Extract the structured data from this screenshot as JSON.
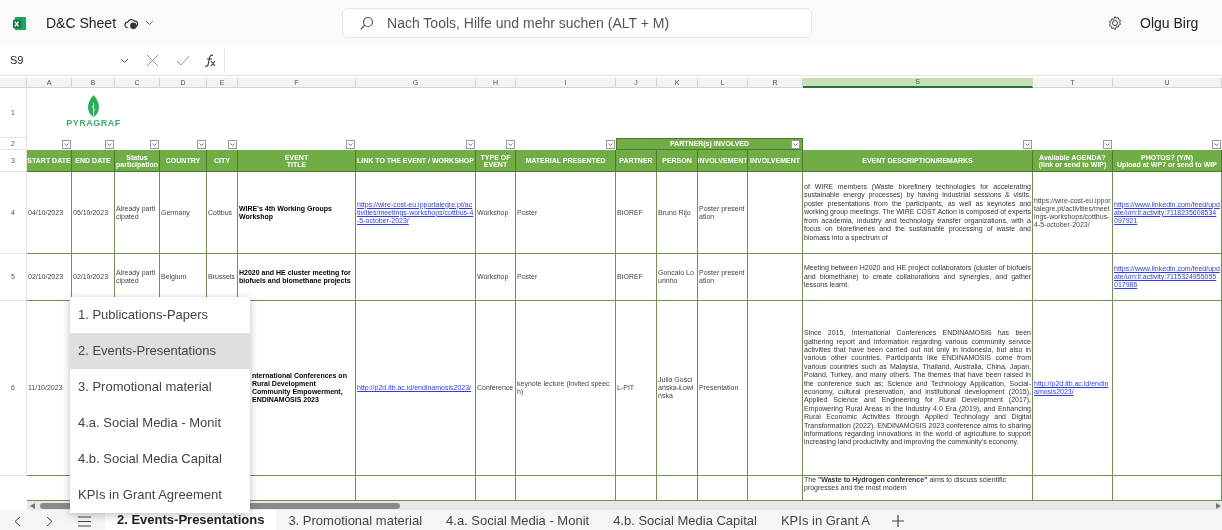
{
  "app": {
    "file_name": "D&C Sheet",
    "search_placeholder": "Nach Tools, Hilfe und mehr suchen (ALT + M)",
    "user": "Olgu Birg"
  },
  "formula_bar": {
    "name_box": "S9"
  },
  "column_letters": [
    {
      "letter": "A",
      "selected": false
    },
    {
      "letter": "B",
      "selected": false
    },
    {
      "letter": "C",
      "selected": false
    },
    {
      "letter": "D",
      "selected": false
    },
    {
      "letter": "E",
      "selected": false
    },
    {
      "letter": "F",
      "selected": false
    },
    {
      "letter": "G",
      "selected": false
    },
    {
      "letter": "H",
      "selected": false
    },
    {
      "letter": "I",
      "selected": false
    },
    {
      "letter": "J",
      "selected": false
    },
    {
      "letter": "K",
      "selected": false
    },
    {
      "letter": "L",
      "selected": false
    },
    {
      "letter": "R",
      "selected": false
    },
    {
      "letter": "S",
      "selected": true
    },
    {
      "letter": "T",
      "selected": false
    },
    {
      "letter": "U",
      "selected": false
    }
  ],
  "logo": {
    "text": "PYRAGRAF"
  },
  "row_numbers": [
    "1",
    "2",
    "3"
  ],
  "partner_group": {
    "label": "PARTNER(s) INVOLVED",
    "filter": true
  },
  "headers": [
    {
      "label": "START DATE",
      "filter": true
    },
    {
      "label": "END DATE",
      "filter": true
    },
    {
      "label": "Status participation",
      "filter": true
    },
    {
      "label": "COUNTRY",
      "filter": true
    },
    {
      "label": "CITY",
      "filter": true
    },
    {
      "label": "EVENT\nTITLE",
      "filter": true
    },
    {
      "label": "LINK TO THE EVENT / WORKSHOP",
      "filter": true
    },
    {
      "label": "TYPE OF EVENT",
      "filter": true
    },
    {
      "label": "MATERIAL PRESENTED",
      "filter": true
    },
    {
      "label": "PARTNER",
      "filter": false
    },
    {
      "label": "PERSON",
      "filter": false
    },
    {
      "label": "INVOLVEMENT",
      "filter": false
    },
    {
      "label": "INVOLVEMENT",
      "filter": false
    },
    {
      "label": "EVENT DESCRIPTION/REMARKS",
      "filter": true
    },
    {
      "label": "Available AGENDA? (link or send to WIP)",
      "filter": true
    },
    {
      "label": "PHOTOS? (Y/N)\nUpload at WP7 or send to WIP",
      "filter": true
    }
  ],
  "rows": [
    {
      "number": "4",
      "cells": {
        "start_date": {
          "kind": "text",
          "text": "04/10/2023"
        },
        "end_date": {
          "kind": "text",
          "text": "05/10/2023"
        },
        "status": {
          "kind": "text",
          "text": "Already participated"
        },
        "country": {
          "kind": "text",
          "text": "Germany"
        },
        "city": {
          "kind": "text",
          "text": "Cottbus"
        },
        "event_title": {
          "kind": "title",
          "text": "WIRE's 4th Working Groups Workshop"
        },
        "event_link": {
          "kind": "link",
          "text": "https://wire-cost-eu.ipportalegre.pt/activities/meetings-workshops/cottbus-4-5-october-2023/"
        },
        "event_type": {
          "kind": "text",
          "text": "Workshop"
        },
        "material": {
          "kind": "text",
          "text": "Poster"
        },
        "partner": {
          "kind": "text",
          "text": "BIOREF"
        },
        "person": {
          "kind": "text",
          "text": "Bruno Rijo"
        },
        "involvement": {
          "kind": "text",
          "text": "Poster presentation"
        },
        "description": {
          "kind": "para",
          "text": "of WIRE members (Waste biorefinery technologies for accelerating sustainable energy processes) by having industrial sessions & visits, poster presentations from the participants, as well as keynotes and working group meetings. The WIRE COST Action is composed of experts from academia, industry and technology transfer organizations, with a focus on biorefineries and the sustainable processing of waste and biomass into a spectrum of"
        },
        "agenda": {
          "kind": "text",
          "text": "https://wire-cost-eu.ipportalegre.pt/activities/meetings-workshops/cottbus-4-5-october-2023/"
        },
        "photos": {
          "kind": "link",
          "text": "https://www.linkedin.com/feed/update/urn:li:activity:7118235608534097921"
        }
      }
    },
    {
      "number": "5",
      "cells": {
        "start_date": {
          "kind": "text",
          "text": "02/10/2023"
        },
        "end_date": {
          "kind": "text",
          "text": "02/10/2023"
        },
        "status": {
          "kind": "text",
          "text": "Already participated"
        },
        "country": {
          "kind": "text",
          "text": "Belgium"
        },
        "city": {
          "kind": "text",
          "text": "Brussels"
        },
        "event_title": {
          "kind": "title",
          "text": "H2020 and HE cluster meeting for biofuels and biomethane projects"
        },
        "event_type": {
          "kind": "text",
          "text": "Workshop"
        },
        "material": {
          "kind": "text",
          "text": "Poster"
        },
        "partner": {
          "kind": "text",
          "text": "BIOREF"
        },
        "person": {
          "kind": "text",
          "text": "Goncalo Lourinho"
        },
        "involvement": {
          "kind": "text",
          "text": "Poster presentation"
        },
        "description": {
          "kind": "para",
          "text": "Meeting between H2020 and HE project collaborators (cluster of biofuels and biomethane) to create collaborations and synergies, and gather lessons learnt."
        },
        "photos": {
          "kind": "link",
          "text": "https://www.linkedin.com/feed/update/urn:li:activity:7115324955055017986"
        }
      }
    },
    {
      "number": "6",
      "cells": {
        "start_date": {
          "kind": "text",
          "text": "11/10/2023"
        },
        "event_title": {
          "kind": "title",
          "text": "nternational Conferences on Rural Development Community Empowerment, ENDINAMOSIS 2023"
        },
        "event_link": {
          "kind": "link",
          "text": "http://p2d.itb.ac.id/endinamosis2023/"
        },
        "event_type": {
          "kind": "text",
          "text": "Conference"
        },
        "material": {
          "kind": "text",
          "text": "keynote lecture (invited speech)"
        },
        "partner": {
          "kind": "text",
          "text": "L-PIT"
        },
        "person": {
          "kind": "text",
          "text": "Julia Gościańska-Łowińska"
        },
        "involvement": {
          "kind": "text",
          "text": "Presentation"
        },
        "description": {
          "kind": "para",
          "text": "Since 2015, International Conferences ENDINAMOSIS has been gathering report and information regarding various community service activities that have been carried out not only in Indonesia, but also in various other countries. Participants like ENDINAMOSIS come from various countries such as Malaysia, Thailand, Australia, China, Japan, Poland, Turkey, and many others. The themes that have been raised in the conference such as; Science and Technology Application, Social-economy, cultural preservation, and institutional development (2015), Applied Science and Engineering for Rural Development (2017), Empowering Rural Areas in the Industry 4.0 Era (2019), and Enhancing Rural Economic Activities through Applied Technology and Digital Transformation (2022). ENDINAMOSIS 2023 conference aims to sharing informations regarding innovations in the world of agriculture to support increasing land productivity and improving the community's economy."
        },
        "agenda": {
          "kind": "link",
          "text": "http://p2d.itb.ac.id/endinamosis2023/"
        }
      }
    },
    {
      "cells": {
        "description": {
          "kind": "para",
          "text": "The **\"Waste to Hydrogen conference\"** aims to discuss scientific progresses and the most modern"
        }
      }
    }
  ],
  "sheet_menu": [
    {
      "label": "1. Publications-Papers",
      "selected": false
    },
    {
      "label": "2. Events-Presentations",
      "selected": true
    },
    {
      "label": "3. Promotional material",
      "selected": false
    },
    {
      "label": "4.a. Social Media - Monit",
      "selected": false
    },
    {
      "label": "4.b. Social Media Capital",
      "selected": false
    },
    {
      "label": "KPIs in Grant Agreement",
      "selected": false
    }
  ],
  "sheet_tabs": [
    {
      "label": "2. Events-Presentations",
      "selected": true
    },
    {
      "label": "3. Promotional material",
      "selected": false
    },
    {
      "label": "4.a. Social Media - Monit",
      "selected": false
    },
    {
      "label": "4.b. Social Media Capital",
      "selected": false
    },
    {
      "label": "KPIs in Grant A",
      "selected": false
    }
  ]
}
